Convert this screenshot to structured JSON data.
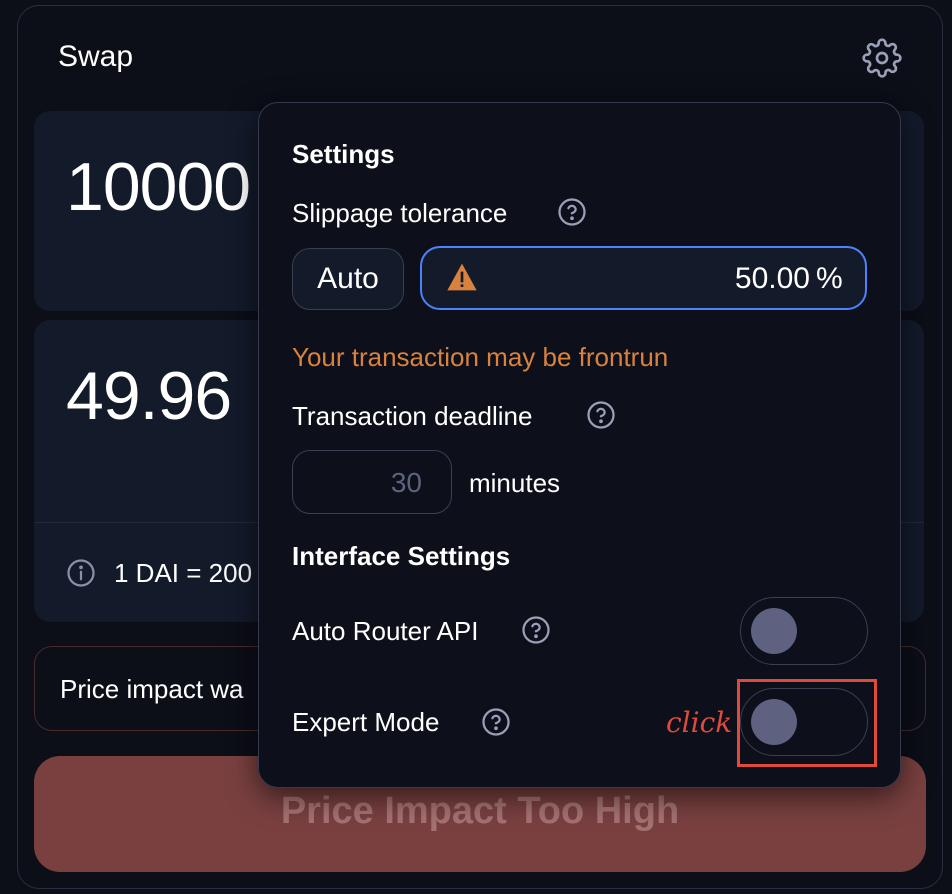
{
  "swap": {
    "title": "Swap",
    "input_amount": "10000",
    "output_amount": "49.96",
    "rate_text": "1 DAI = 200",
    "price_impact_text": "Price impact wa",
    "action_button_label": "Price Impact Too High"
  },
  "settings": {
    "title": "Settings",
    "slippage_label": "Slippage tolerance",
    "auto_label": "Auto",
    "slippage_value": "50.00",
    "slippage_unit": "%",
    "frontrun_warning": "Your transaction may be frontrun",
    "deadline_label": "Transaction deadline",
    "deadline_value": "30",
    "deadline_unit": "minutes",
    "interface_title": "Interface Settings",
    "auto_router_label": "Auto Router API",
    "auto_router_enabled": false,
    "expert_mode_label": "Expert Mode",
    "expert_mode_enabled": false
  },
  "annotation": {
    "click_text": "click",
    "color": "#e04a3a"
  },
  "colors": {
    "accent_blue": "#4c82fb",
    "warning_orange": "#d8823d",
    "error_button": "#7a4040"
  },
  "icons": {
    "settings": "gear-icon",
    "info": "info-icon",
    "help": "question-circle-icon",
    "warning": "alert-triangle-icon"
  }
}
